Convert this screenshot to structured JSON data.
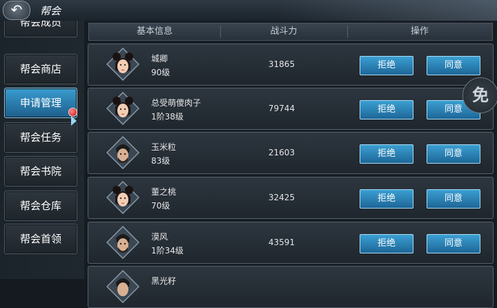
{
  "topbar": {
    "back_icon": "↶",
    "title": "帮会"
  },
  "sidebar": {
    "items": [
      {
        "label": "帮会成员",
        "active": false
      },
      {
        "label": "帮会商店",
        "active": false
      },
      {
        "label": "申请管理",
        "active": true
      },
      {
        "label": "帮会任务",
        "active": false
      },
      {
        "label": "帮会书院",
        "active": false
      },
      {
        "label": "帮会仓库",
        "active": false
      },
      {
        "label": "帮会首领",
        "active": false
      }
    ]
  },
  "table": {
    "headers": [
      "基本信息",
      "战斗力",
      "操作"
    ],
    "reject_label": "拒绝",
    "agree_label": "同意",
    "rows": [
      {
        "name": "城卿",
        "level": "90级",
        "power": "31865",
        "avatar": "female"
      },
      {
        "name": "总受萌傻肉子",
        "level": "1阶38级",
        "power": "79744",
        "avatar": "female"
      },
      {
        "name": "玉米粒",
        "level": "83级",
        "power": "21603",
        "avatar": "male"
      },
      {
        "name": "董之桃",
        "level": "70级",
        "power": "32425",
        "avatar": "female"
      },
      {
        "name": "漠风",
        "level": "1阶34级",
        "power": "43591",
        "avatar": "male"
      },
      {
        "name": "黑光籽",
        "level": "",
        "power": "",
        "avatar": "male"
      }
    ]
  },
  "side_badge": {
    "label": "免"
  },
  "colors": {
    "accent": "#2f8cc4",
    "panel": "#262e36",
    "border": "#56616b"
  }
}
